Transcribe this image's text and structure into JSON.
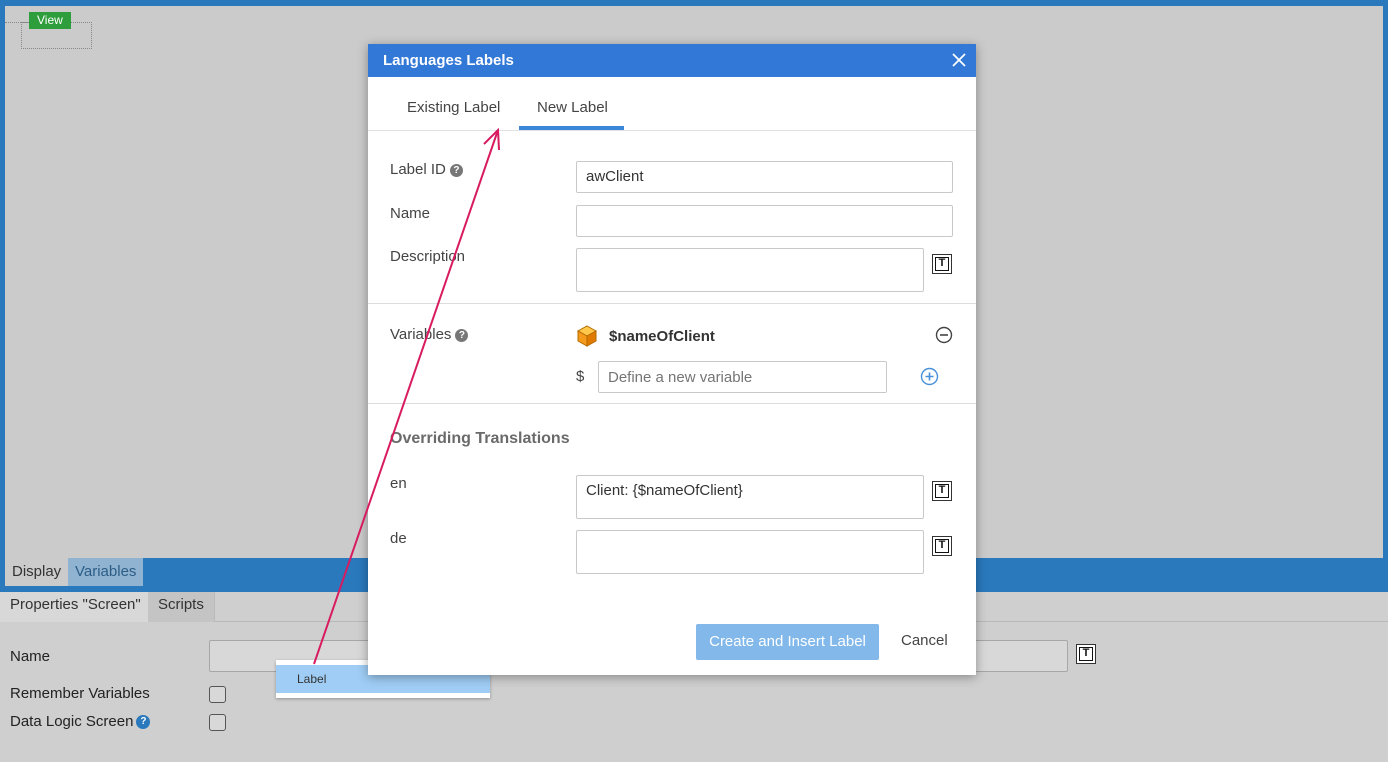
{
  "canvas": {
    "view_tag": "View"
  },
  "bottom_tabs": {
    "display": "Display",
    "variables": "Variables"
  },
  "properties": {
    "tab_properties": "Properties \"Screen\"",
    "tab_scripts": "Scripts",
    "name_label": "Name",
    "remember_label": "Remember Variables",
    "datalogic_label": "Data Logic Screen",
    "help_glyph": "?",
    "text_icon_glyph": "T"
  },
  "dropdown": {
    "item": "Label"
  },
  "dialog": {
    "title": "Languages Labels",
    "tabs": {
      "existing": "Existing Label",
      "new": "New Label"
    },
    "fields": {
      "label_id": "Label ID",
      "label_id_value": "awClient",
      "name": "Name",
      "name_value": "",
      "description": "Description",
      "description_value": ""
    },
    "variables": {
      "label": "Variables",
      "item": "$nameOfClient",
      "dollar": "$",
      "placeholder": "Define a new variable"
    },
    "translations": {
      "title": "Overriding Translations",
      "en_label": "en",
      "en_value": "Client: {$nameOfClient}",
      "de_label": "de",
      "de_value": ""
    },
    "buttons": {
      "create": "Create and Insert Label",
      "cancel": "Cancel"
    }
  },
  "colors": {
    "frame_blue": "#2a79bd",
    "dialog_header": "#3278d6",
    "primary_button": "#82b8ea",
    "view_tag": "#2e9e3c",
    "arrow": "#d81b60"
  }
}
